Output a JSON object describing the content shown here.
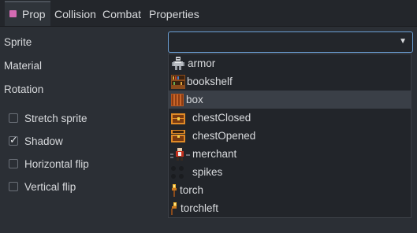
{
  "tabs": [
    {
      "label": "Prop",
      "active": true,
      "swatch_color": "#d36ab2"
    },
    {
      "label": "Collision",
      "active": false
    },
    {
      "label": "Combat",
      "active": false
    },
    {
      "label": "Properties",
      "active": false
    }
  ],
  "fields": {
    "sprite_label": "Sprite",
    "material_label": "Material",
    "rotation_label": "Rotation"
  },
  "sprite_select": {
    "value": "",
    "chevron_icon": "chevron-down-icon",
    "focus_color": "#6ba0d6"
  },
  "checkboxes": [
    {
      "label": "Stretch sprite",
      "checked": false
    },
    {
      "label": "Shadow",
      "checked": true
    },
    {
      "label": "Horizontal flip",
      "checked": false
    },
    {
      "label": "Vertical flip",
      "checked": false
    }
  ],
  "dropdown": {
    "options": [
      {
        "label": "armor",
        "icon": "armor-sprite-icon"
      },
      {
        "label": "bookshelf",
        "icon": "bookshelf-sprite-icon"
      },
      {
        "label": "box",
        "icon": "box-sprite-icon",
        "selected": true
      },
      {
        "label": "chestClosed",
        "icon": "chest-closed-sprite-icon"
      },
      {
        "label": "chestOpened",
        "icon": "chest-opened-sprite-icon"
      },
      {
        "label": "merchant",
        "icon": "merchant-sprite-icon"
      },
      {
        "label": "spikes",
        "icon": "spikes-sprite-icon"
      },
      {
        "label": "torch",
        "icon": "torch-sprite-icon"
      },
      {
        "label": "torchleft",
        "icon": "torch-left-sprite-icon"
      }
    ]
  },
  "colors": {
    "background": "#2b2f35",
    "tabbar": "#23262b",
    "dropdown_bg": "#22252a",
    "selected_row": "#3a3f47"
  }
}
